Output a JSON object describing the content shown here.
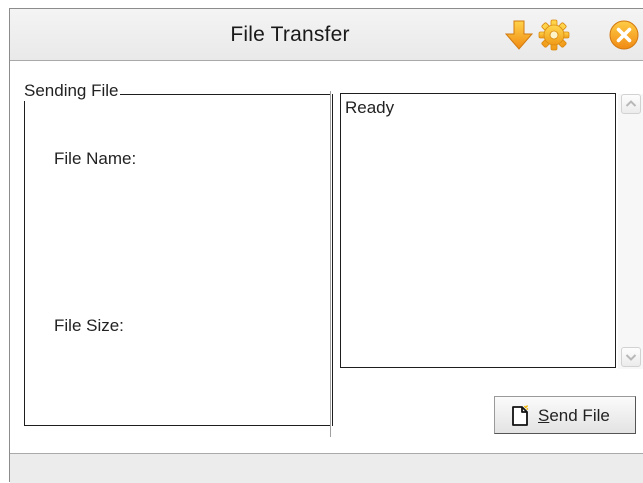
{
  "window": {
    "title": "File Transfer",
    "titlebar_icons": [
      "download-arrow-icon",
      "gear-icon",
      "close-icon"
    ]
  },
  "sending_group": {
    "legend": "Sending File",
    "file_name_label": "File Name:",
    "file_size_label": "File Size:"
  },
  "log": {
    "text": "Ready"
  },
  "send_button": {
    "mnemonic": "S",
    "rest": "end File",
    "icon": "new-file-icon"
  },
  "colors": {
    "accent_orange": "#f5a623",
    "title_bg": "#efefef",
    "status_bg": "#ececec"
  }
}
